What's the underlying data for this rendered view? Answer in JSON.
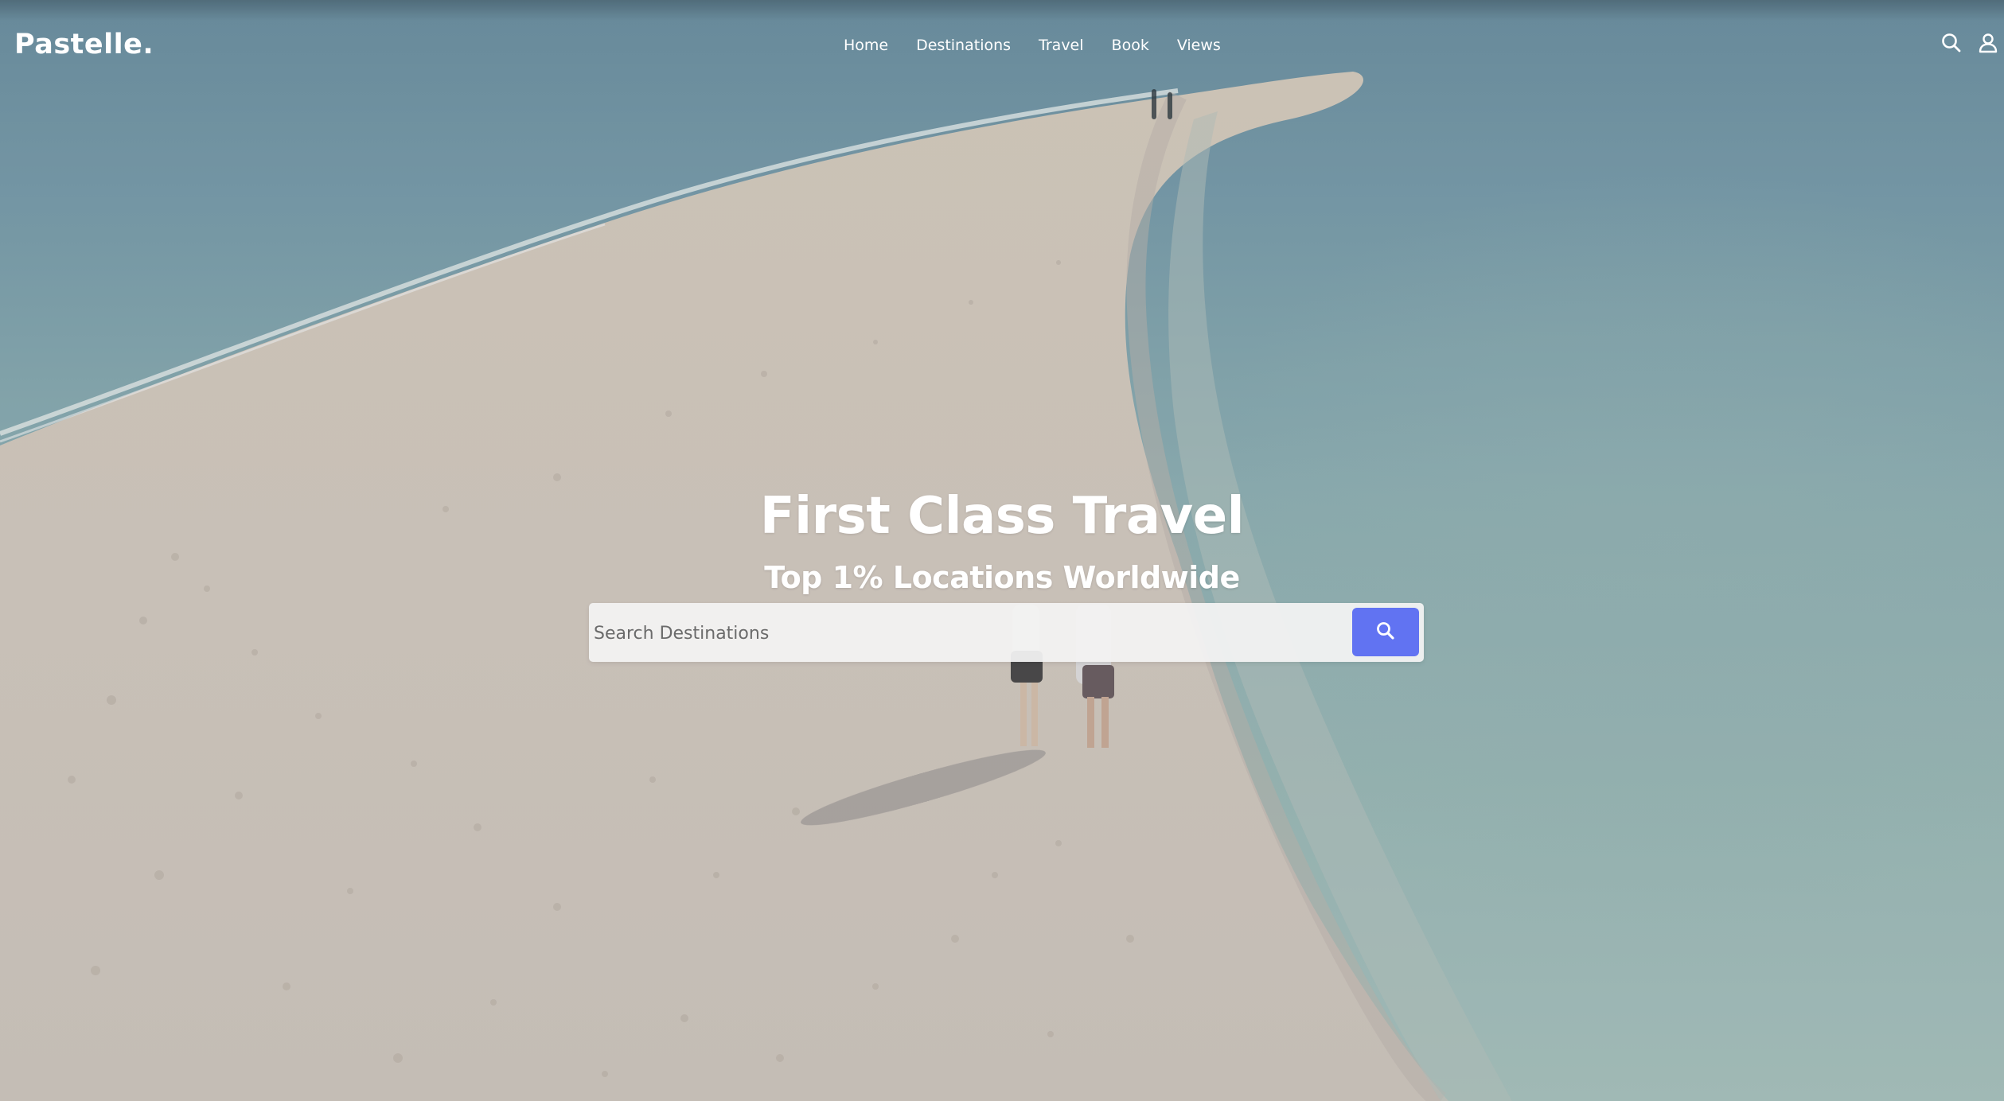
{
  "header": {
    "logo": "Pastelle.",
    "nav": [
      {
        "label": "Home"
      },
      {
        "label": "Destinations"
      },
      {
        "label": "Travel"
      },
      {
        "label": "Book"
      },
      {
        "label": "Views"
      }
    ],
    "icons": {
      "search": "search-icon",
      "account": "user-icon"
    }
  },
  "hero": {
    "title": "First Class Travel",
    "subtitle": "Top 1% Locations Worldwide",
    "search": {
      "placeholder": "Search Destinations",
      "value": "",
      "button_icon": "search-icon"
    }
  },
  "colors": {
    "accent": "#6173f2",
    "text": "#ffffff",
    "search_bg": "#f2f2f2"
  }
}
